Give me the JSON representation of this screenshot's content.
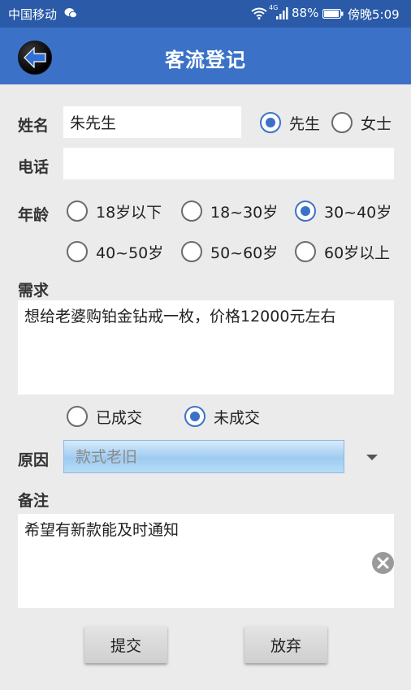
{
  "status_bar": {
    "carrier": "中国移动",
    "network_type": "4G",
    "battery": "88%",
    "time": "傍晚5:09"
  },
  "header": {
    "title": "客流登记",
    "back_icon": "arrow-left-icon"
  },
  "form": {
    "name": {
      "label": "姓名",
      "value": "朱先生"
    },
    "gender": {
      "options": [
        "先生",
        "女士"
      ],
      "selected": "先生"
    },
    "phone": {
      "label": "电话",
      "value": ""
    },
    "age": {
      "label": "年龄",
      "options": [
        "18岁以下",
        "18~30岁",
        "30~40岁",
        "40~50岁",
        "50~60岁",
        "60岁以上"
      ],
      "selected": "30~40岁"
    },
    "demand": {
      "label": "需求",
      "value": "想给老婆购铂金钻戒一枚，价格12000元左右"
    },
    "deal": {
      "options": [
        "已成交",
        "未成交"
      ],
      "selected": "未成交"
    },
    "reason": {
      "label": "原因",
      "value": "款式老旧"
    },
    "remark": {
      "label": "备注",
      "value": "希望有新款能及时通知"
    }
  },
  "buttons": {
    "submit": "提交",
    "abandon": "放弃"
  },
  "colors": {
    "status_bar": "#2a5aa8",
    "app_bar": "#3b72c8",
    "accent": "#3b72c8",
    "background": "#ebebeb"
  }
}
